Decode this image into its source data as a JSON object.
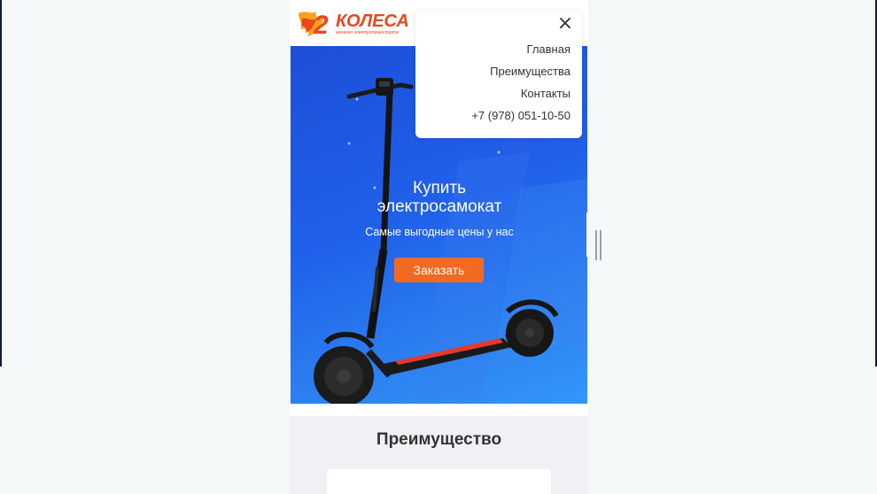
{
  "logo": {
    "brand": "КОЛЕСА",
    "digit": "2",
    "tagline": "магазин электротранспорта"
  },
  "hero": {
    "title": "Купить электросамокат",
    "subtitle": "Самые выгодные цены у нас",
    "cta_label": "Заказать"
  },
  "menu": {
    "close_icon": "×",
    "items": [
      {
        "label": "Главная"
      },
      {
        "label": "Преимущества"
      },
      {
        "label": "Контакты"
      },
      {
        "label": "+7 (978) 051-10-50"
      }
    ]
  },
  "section": {
    "title": "Преимущество"
  },
  "colors": {
    "hero_gradient_start": "#1d4fd8",
    "hero_gradient_end": "#3398ff",
    "cta": "#f26a22",
    "logo_primary": "#e8481c",
    "logo_accent": "#f7a21b"
  }
}
